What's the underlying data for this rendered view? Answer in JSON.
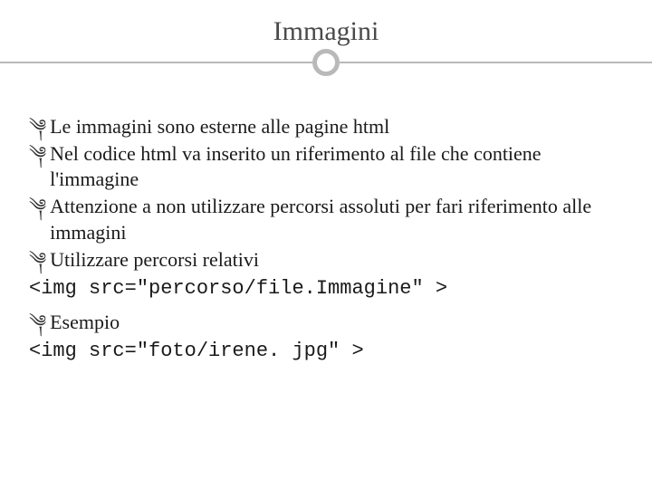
{
  "title": "Immagini",
  "bullets": {
    "b1": "Le immagini sono esterne alle pagine html",
    "b2": "Nel codice html va inserito un riferimento al file che contiene l'immagine",
    "b3": "Attenzione a non utilizzare percorsi assoluti per fari riferimento alle immagini",
    "b4": "Utilizzare percorsi relativi",
    "b5": "Esempio"
  },
  "code": {
    "c1": "<img src=\"percorso/file.Immagine\" >",
    "c2": "<img src=\"foto/irene. jpg\" >"
  },
  "glyph": "་"
}
